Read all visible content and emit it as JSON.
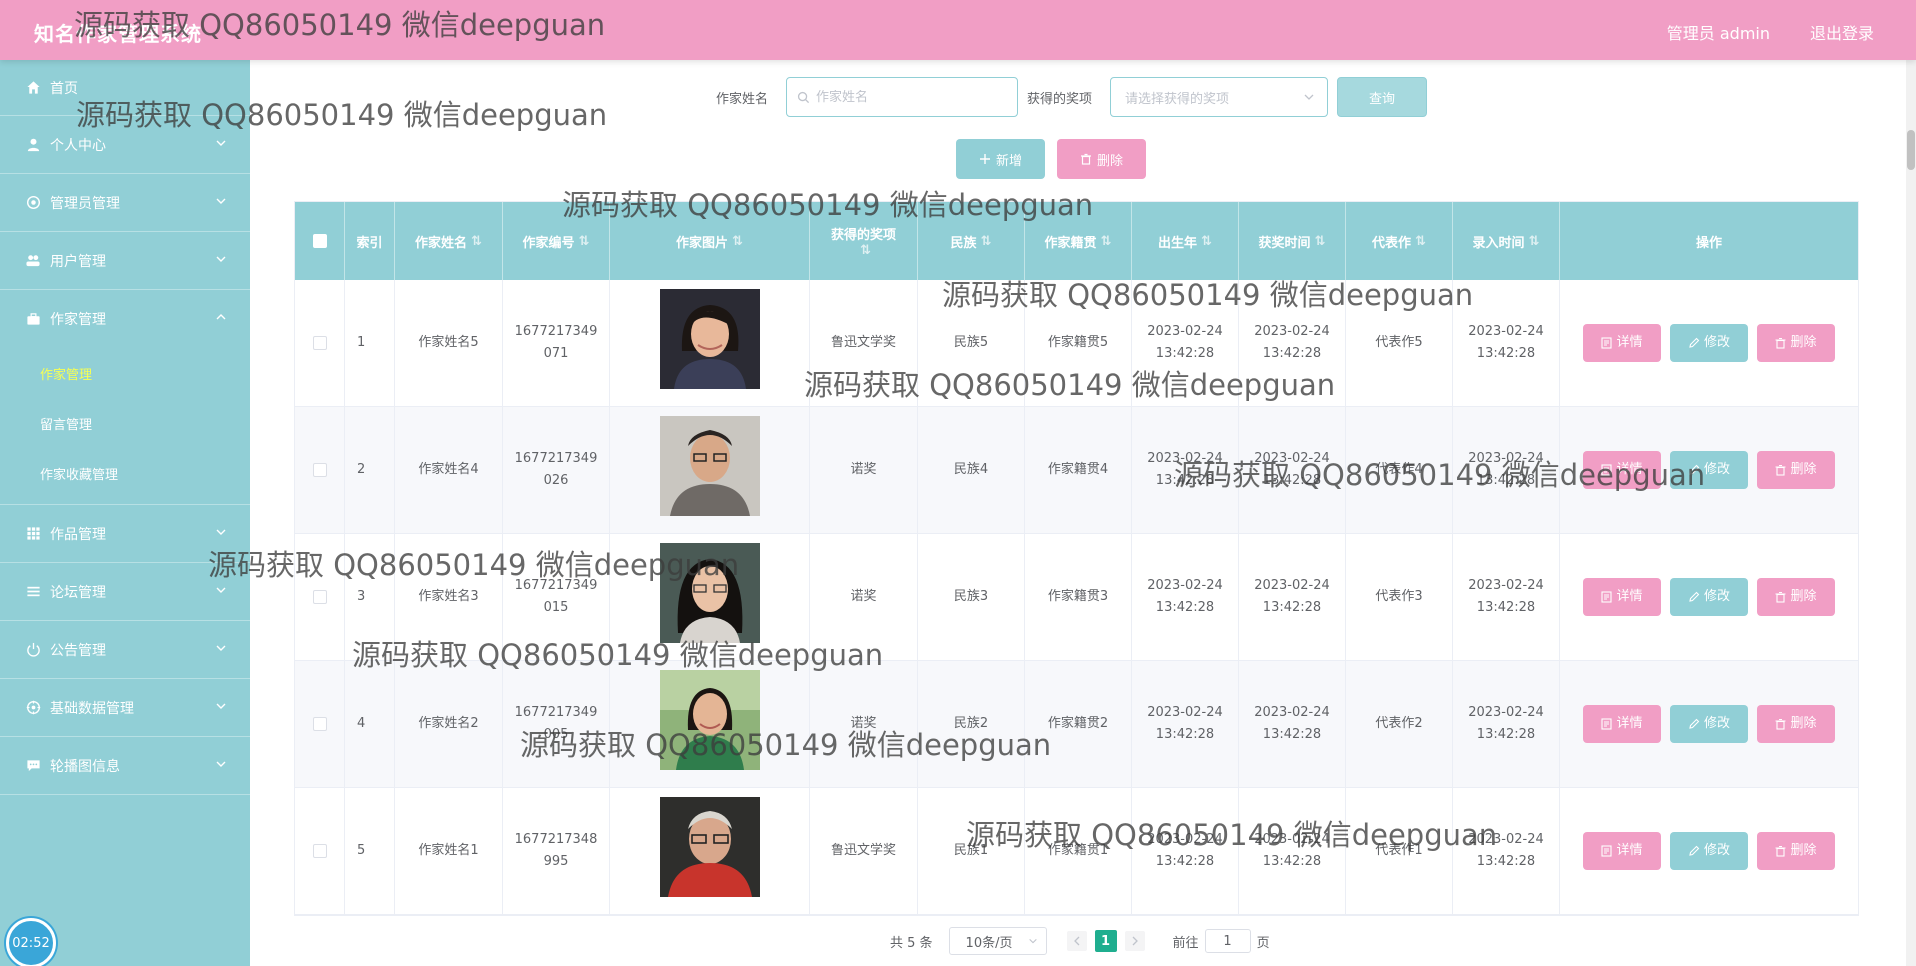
{
  "header": {
    "title": "知名作家管理系统",
    "user_label": "管理员 admin",
    "logout_label": "退出登录"
  },
  "sidebar": {
    "items": [
      {
        "label": "首页",
        "icon": "home-icon"
      },
      {
        "label": "个人中心",
        "icon": "user-icon"
      },
      {
        "label": "管理员管理",
        "icon": "admin-icon"
      },
      {
        "label": "用户管理",
        "icon": "users-icon"
      },
      {
        "label": "作家管理",
        "icon": "briefcase-icon"
      },
      {
        "label": "作品管理",
        "icon": "grid-icon"
      },
      {
        "label": "论坛管理",
        "icon": "list-icon"
      },
      {
        "label": "公告管理",
        "icon": "power-icon"
      },
      {
        "label": "基础数据管理",
        "icon": "settings-icon"
      },
      {
        "label": "轮播图信息",
        "icon": "message-icon"
      }
    ],
    "submenu": [
      {
        "label": "作家管理"
      },
      {
        "label": "留言管理"
      },
      {
        "label": "作家收藏管理"
      }
    ],
    "clock": "02:52"
  },
  "search": {
    "name_label": "作家姓名",
    "name_placeholder": "作家姓名",
    "award_label": "获得的奖项",
    "award_placeholder": "请选择获得的奖项",
    "query_label": "查询"
  },
  "actions": {
    "add_label": "新增",
    "delete_label": "删除"
  },
  "table": {
    "headers": [
      "索引",
      "作家姓名",
      "作家编号",
      "作家图片",
      "获得的奖项",
      "民族",
      "作家籍贯",
      "出生年",
      "获奖时间",
      "代表作",
      "录入时间",
      "操作"
    ],
    "op_labels": {
      "detail": "详情",
      "edit": "修改",
      "delete": "删除"
    },
    "rows": [
      {
        "index": "1",
        "name": "作家姓名5",
        "code1": "1677217349",
        "code2": "071",
        "award": "鲁迅文学奖",
        "ethnic": "民族5",
        "origin": "作家籍贯5",
        "birth_d": "2023-02-24",
        "birth_t": "13:42:28",
        "award_d": "2023-02-24",
        "award_t": "13:42:28",
        "work": "代表作5",
        "entry_d": "2023-02-24",
        "entry_t": "13:42:28"
      },
      {
        "index": "2",
        "name": "作家姓名4",
        "code1": "1677217349",
        "code2": "026",
        "award": "诺奖",
        "ethnic": "民族4",
        "origin": "作家籍贯4",
        "birth_d": "2023-02-24",
        "birth_t": "13:42:28",
        "award_d": "2023-02-24",
        "award_t": "13:42:28",
        "work": "代表作4",
        "entry_d": "2023-02-24",
        "entry_t": "13:42:28"
      },
      {
        "index": "3",
        "name": "作家姓名3",
        "code1": "1677217349",
        "code2": "015",
        "award": "诺奖",
        "ethnic": "民族3",
        "origin": "作家籍贯3",
        "birth_d": "2023-02-24",
        "birth_t": "13:42:28",
        "award_d": "2023-02-24",
        "award_t": "13:42:28",
        "work": "代表作3",
        "entry_d": "2023-02-24",
        "entry_t": "13:42:28"
      },
      {
        "index": "4",
        "name": "作家姓名2",
        "code1": "1677217349",
        "code2": "005",
        "award": "诺奖",
        "ethnic": "民族2",
        "origin": "作家籍贯2",
        "birth_d": "2023-02-24",
        "birth_t": "13:42:28",
        "award_d": "2023-02-24",
        "award_t": "13:42:28",
        "work": "代表作2",
        "entry_d": "2023-02-24",
        "entry_t": "13:42:28"
      },
      {
        "index": "5",
        "name": "作家姓名1",
        "code1": "1677217348",
        "code2": "995",
        "award": "鲁迅文学奖",
        "ethnic": "民族1",
        "origin": "作家籍贯1",
        "birth_d": "2023-02-24",
        "birth_t": "13:42:28",
        "award_d": "2023-02-24",
        "award_t": "13:42:28",
        "work": "代表作1",
        "entry_d": "2023-02-24",
        "entry_t": "13:42:28"
      }
    ]
  },
  "pagination": {
    "total": "共 5 条",
    "page_size": "10条/页",
    "current": "1",
    "goto_label": "前往",
    "goto_value": "1",
    "page_suffix": "页"
  },
  "watermark": {
    "text": "源码获取 QQ86050149 微信deepguan"
  },
  "colors": {
    "header": "#f19ec5",
    "sidebar": "#91cfd6",
    "accent_pink": "#f19ec5",
    "accent_teal": "#91cfd6",
    "active_submenu": "#f5ff54",
    "pager_active": "#1fae8f"
  }
}
